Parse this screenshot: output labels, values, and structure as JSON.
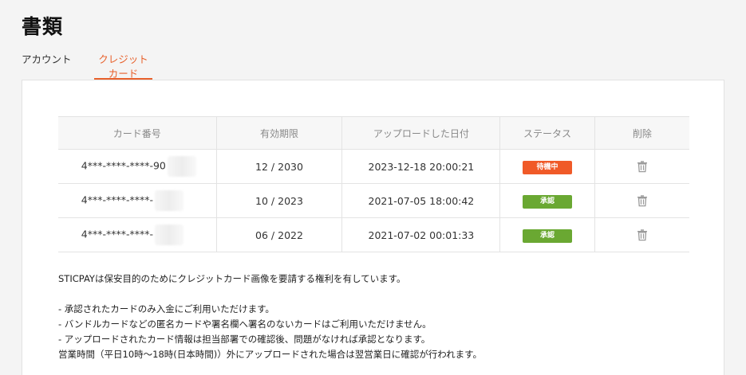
{
  "page": {
    "title": "書類"
  },
  "tabs": [
    {
      "label": "アカウント",
      "active": false
    },
    {
      "label": "クレジットカード",
      "active": true
    }
  ],
  "colors": {
    "accent": "#e8612c",
    "pending": "#f05a28",
    "approved": "#6aa832"
  },
  "table": {
    "headers": [
      "カード番号",
      "有効期限",
      "アップロードした日付",
      "ステータス",
      "削除"
    ],
    "rows": [
      {
        "card_number": "4***-****-****-90",
        "expiry": "12 / 2030",
        "uploaded": "2023-12-18 20:00:21",
        "status": "待機中",
        "status_kind": "pending",
        "delete_icon": "trash-icon"
      },
      {
        "card_number": "4***-****-****-",
        "expiry": "10 / 2023",
        "uploaded": "2021-07-05 18:00:42",
        "status": "承認",
        "status_kind": "approved",
        "delete_icon": "trash-icon"
      },
      {
        "card_number": "4***-****-****-",
        "expiry": "06 / 2022",
        "uploaded": "2021-07-02 00:01:33",
        "status": "承認",
        "status_kind": "approved",
        "delete_icon": "trash-icon"
      }
    ]
  },
  "notes": {
    "intro": "STICPAYは保安目的のためにクレジットカード画像を要請する権利を有しています。",
    "items": [
      "- 承認されたカードのみ入金にご利用いただけます。",
      "- バンドルカードなどの匿名カードや署名欄へ署名のないカードはご利用いただけません。",
      "- アップロードされたカード情報は担当部署での確認後、問題がなければ承認となります。"
    ],
    "hours": "営業時間（平日10時～18時(日本時間)）外にアップロードされた場合は翌営業日に確認が行われます。"
  }
}
